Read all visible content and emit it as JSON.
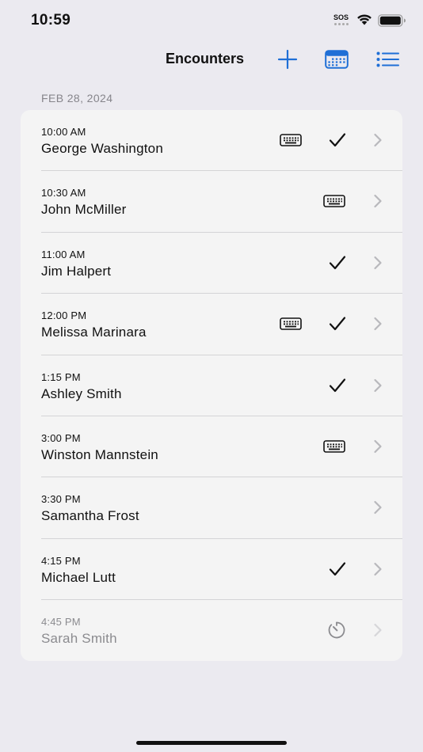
{
  "status_bar": {
    "time": "10:59",
    "sos": "SOS"
  },
  "nav": {
    "title": "Encounters",
    "add_icon": "plus-icon",
    "calendar_icon": "calendar-icon",
    "list_icon": "list-icon"
  },
  "colors": {
    "accent": "#1f6fd6",
    "background": "#ebeaf0",
    "card": "#f4f4f4",
    "secondary_text": "#86858b"
  },
  "section": {
    "date": "FEB 28, 2024"
  },
  "encounters": [
    {
      "time": "10:00 AM",
      "name": "George Washington",
      "keyboard": true,
      "check": true,
      "timer": false,
      "dim": false
    },
    {
      "time": "10:30 AM",
      "name": "John McMiller",
      "keyboard": true,
      "check": false,
      "timer": false,
      "dim": false
    },
    {
      "time": "11:00 AM",
      "name": "Jim Halpert",
      "keyboard": false,
      "check": true,
      "timer": false,
      "dim": false
    },
    {
      "time": "12:00 PM",
      "name": "Melissa Marinara",
      "keyboard": true,
      "check": true,
      "timer": false,
      "dim": false
    },
    {
      "time": "1:15 PM",
      "name": "Ashley Smith",
      "keyboard": false,
      "check": true,
      "timer": false,
      "dim": false
    },
    {
      "time": "3:00 PM",
      "name": "Winston Mannstein",
      "keyboard": true,
      "check": false,
      "timer": false,
      "dim": false
    },
    {
      "time": "3:30 PM",
      "name": "Samantha Frost",
      "keyboard": false,
      "check": false,
      "timer": false,
      "dim": false
    },
    {
      "time": "4:15 PM",
      "name": "Michael Lutt",
      "keyboard": false,
      "check": true,
      "timer": false,
      "dim": false
    },
    {
      "time": "4:45 PM",
      "name": "Sarah Smith",
      "keyboard": false,
      "check": false,
      "timer": true,
      "dim": true
    }
  ]
}
